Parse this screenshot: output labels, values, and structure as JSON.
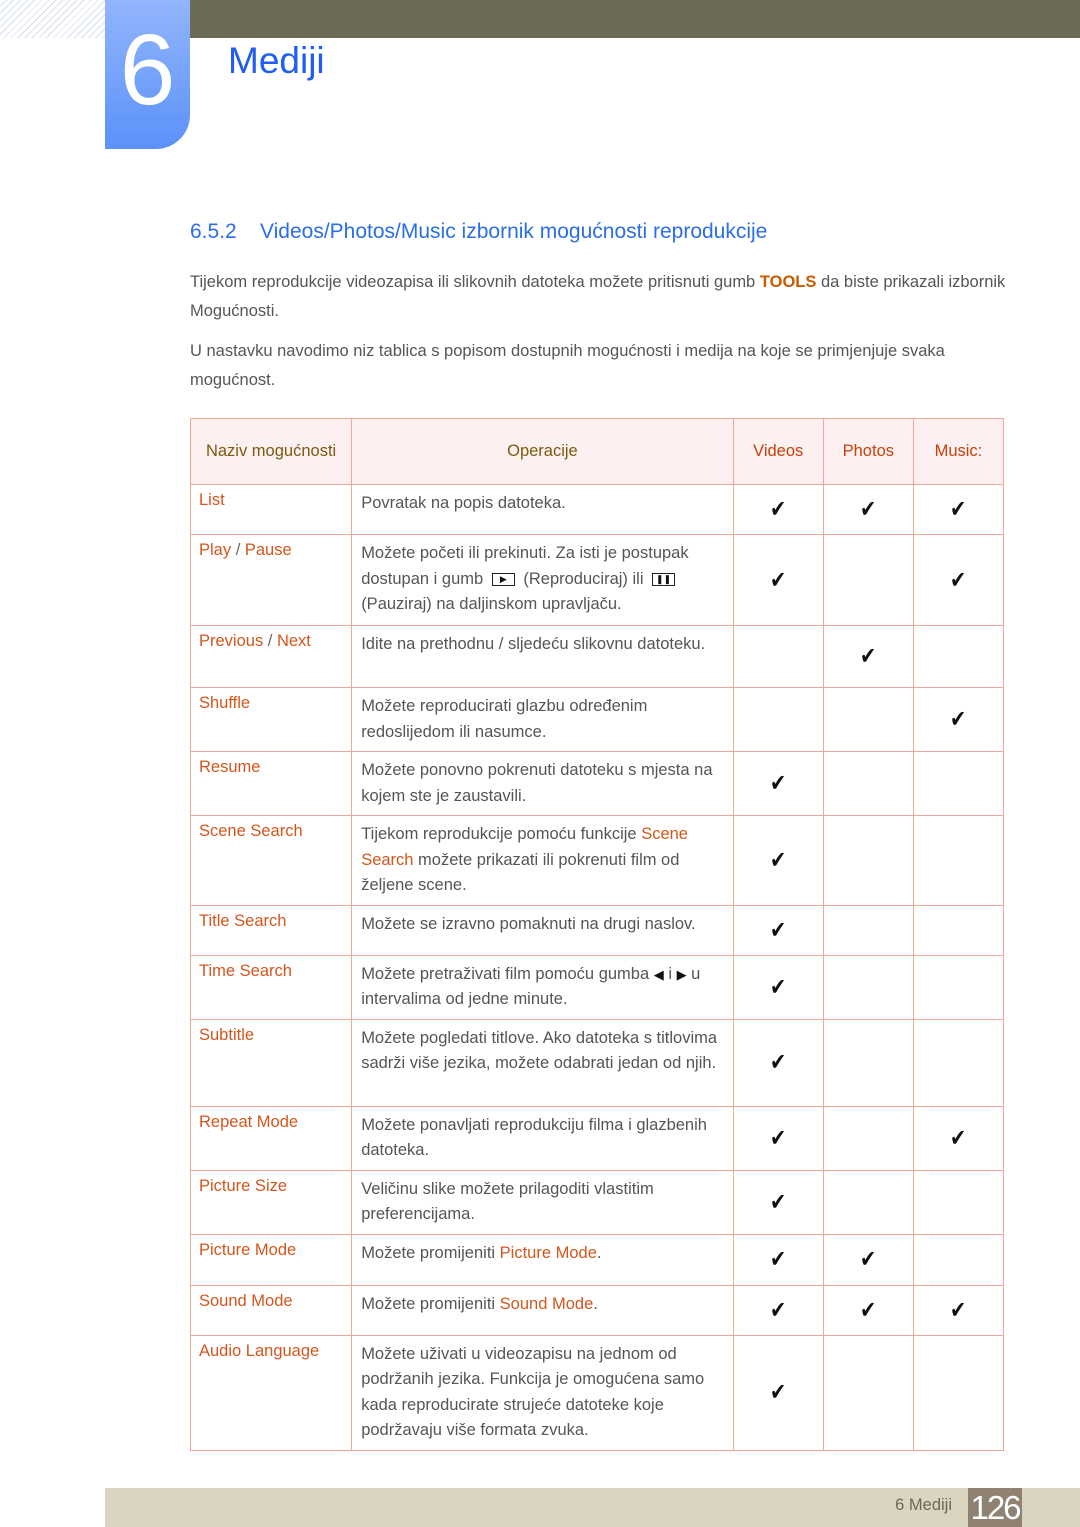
{
  "chapter": {
    "number": "6",
    "title": "Mediji"
  },
  "section": {
    "number": "6.5.2",
    "title": "Videos/Photos/Music izbornik mogućnosti reprodukcije"
  },
  "intro": [
    [
      {
        "t": "Tijekom reprodukcije videozapisa ili slikovnih datoteka možete pritisnuti gumb "
      },
      {
        "t": "TOOLS",
        "hl": true
      },
      {
        "t": " da biste prikazali izbornik Mogućnosti."
      }
    ],
    [
      {
        "t": "U nastavku navodimo niz tablica s popisom dostupnih mogućnosti i medija na koje se primjenjuje svaka mogućnost."
      }
    ]
  ],
  "table": {
    "headers": [
      "Naziv mogućnosti",
      "Operacije",
      "Videos",
      "Photos",
      "Music:"
    ],
    "check_icon": "checkmark-icon",
    "rows": [
      {
        "name": [
          {
            "t": "List"
          }
        ],
        "desc": [
          {
            "t": "Povratak na popis datoteka."
          }
        ],
        "videos": true,
        "photos": true,
        "music": true
      },
      {
        "name": [
          {
            "t": "Play"
          },
          {
            "t": " / ",
            "sep": true
          },
          {
            "t": "Pause"
          }
        ],
        "desc": [
          {
            "t": "Možete početi ili prekinuti. Za isti je postupak dostupan i gumb "
          },
          {
            "icon": "play-button-icon",
            "glyph": "▶"
          },
          {
            "t": " (Reproduciraj) ili "
          },
          {
            "icon": "pause-button-icon",
            "glyph": "❚❚"
          },
          {
            "t": " (Pauziraj) na daljinskom upravljaču."
          }
        ],
        "videos": true,
        "photos": false,
        "music": true
      },
      {
        "name": [
          {
            "t": "Previous"
          },
          {
            "t": " / ",
            "sep": true
          },
          {
            "t": "Next"
          }
        ],
        "desc": [
          {
            "t": "Idite na prethodnu / sljedeću slikovnu datoteku."
          }
        ],
        "videos": false,
        "photos": true,
        "music": false
      },
      {
        "name": [
          {
            "t": "Shuffle"
          }
        ],
        "desc": [
          {
            "t": "Možete reproducirati glazbu određenim redoslijedom ili nasumce."
          }
        ],
        "videos": false,
        "photos": false,
        "music": true
      },
      {
        "name": [
          {
            "t": "Resume"
          }
        ],
        "desc": [
          {
            "t": "Možete ponovno pokrenuti datoteku s mjesta na kojem ste je zaustavili."
          }
        ],
        "videos": true,
        "photos": false,
        "music": false
      },
      {
        "name": [
          {
            "t": "Scene Search"
          }
        ],
        "desc": [
          {
            "t": "Tijekom reprodukcije pomoću funkcije "
          },
          {
            "t": "Scene Search",
            "hl": true
          },
          {
            "t": " možete prikazati ili pokrenuti film od željene scene."
          }
        ],
        "videos": true,
        "photos": false,
        "music": false
      },
      {
        "name": [
          {
            "t": "Title Search"
          }
        ],
        "desc": [
          {
            "t": "Možete se izravno pomaknuti na drugi naslov."
          }
        ],
        "videos": true,
        "photos": false,
        "music": false
      },
      {
        "name": [
          {
            "t": "Time Search"
          }
        ],
        "desc": [
          {
            "t": "Možete pretraživati film pomoću gumba "
          },
          {
            "icon": "left-arrow-icon",
            "glyph": "◀"
          },
          {
            "t": " i "
          },
          {
            "icon": "right-arrow-icon",
            "glyph": "▶"
          },
          {
            "t": " u intervalima od jedne minute."
          }
        ],
        "videos": true,
        "photos": false,
        "music": false
      },
      {
        "name": [
          {
            "t": "Subtitle"
          }
        ],
        "desc": [
          {
            "t": "Možete pogledati titlove. Ako datoteka s titlovima sadrži više jezika, možete odabrati jedan od njih."
          }
        ],
        "videos": true,
        "photos": false,
        "music": false
      },
      {
        "name": [
          {
            "t": "Repeat Mode"
          }
        ],
        "desc": [
          {
            "t": "Možete ponavljati reprodukciju filma i glazbenih datoteka."
          }
        ],
        "videos": true,
        "photos": false,
        "music": true
      },
      {
        "name": [
          {
            "t": "Picture Size"
          }
        ],
        "desc": [
          {
            "t": "Veličinu slike možete prilagoditi vlastitim preferencijama."
          }
        ],
        "videos": true,
        "photos": false,
        "music": false
      },
      {
        "name": [
          {
            "t": "Picture Mode"
          }
        ],
        "desc": [
          {
            "t": "Možete promijeniti "
          },
          {
            "t": "Picture Mode",
            "hl": true
          },
          {
            "t": "."
          }
        ],
        "videos": true,
        "photos": true,
        "music": false
      },
      {
        "name": [
          {
            "t": "Sound Mode"
          }
        ],
        "desc": [
          {
            "t": "Možete promijeniti "
          },
          {
            "t": "Sound Mode",
            "hl": true
          },
          {
            "t": "."
          }
        ],
        "videos": true,
        "photos": true,
        "music": true
      },
      {
        "name": [
          {
            "t": "Audio Language"
          }
        ],
        "desc": [
          {
            "t": "Možete uživati u videozapisu na jednom od podržanih jezika. Funkcija je omogućena samo kada reproducirate strujeće datoteke koje podržavaju više formata zvuka."
          }
        ],
        "videos": true,
        "photos": false,
        "music": false
      }
    ]
  },
  "footer": {
    "chapter_label": "6 Mediji",
    "page": "126"
  },
  "colors": {
    "accent_blue": "#1f5ef0",
    "highlight": "#d4561c",
    "topbar": "#6d6b58",
    "footer": "#dad4c0"
  }
}
